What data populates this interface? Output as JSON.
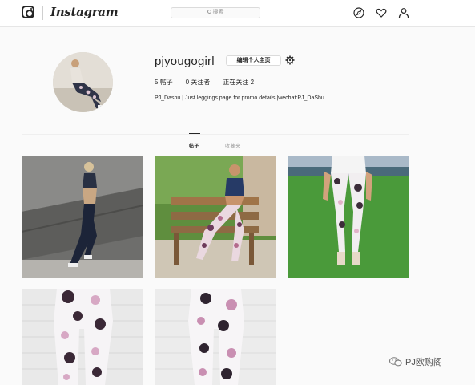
{
  "header": {
    "wordmark": "Instagram",
    "search_placeholder": "搜索",
    "icons": [
      "instagram-logo-icon",
      "compass-icon",
      "heart-icon",
      "person-icon"
    ]
  },
  "profile": {
    "username": "pjyougogirl",
    "edit_label": "编辑个人主页",
    "posts_count": "5 帖子",
    "followers": "0 关注者",
    "following": "正在关注 2",
    "bio": "PJ_Dashu | Just leggings page for promo details |wechat:PJ_DaShu"
  },
  "tabs": [
    {
      "label": "帖子",
      "active": true
    },
    {
      "label": "收藏夹",
      "active": false
    }
  ],
  "posts": [
    {
      "description": "woman in navy sports bra and leggings running by concrete wall"
    },
    {
      "description": "woman in navy sports bra and floral leggings on wooden bench"
    },
    {
      "description": "white tie-dye leggings on grass"
    },
    {
      "description": "white tie-dye leggings close-up"
    },
    {
      "description": "white tie-dye leggings with pink patches close-up"
    }
  ],
  "watermark": "PJ欧购阁",
  "colors": {
    "background": "#fafafa",
    "text": "#262626",
    "muted": "#999999",
    "border": "#dbdbdb"
  }
}
